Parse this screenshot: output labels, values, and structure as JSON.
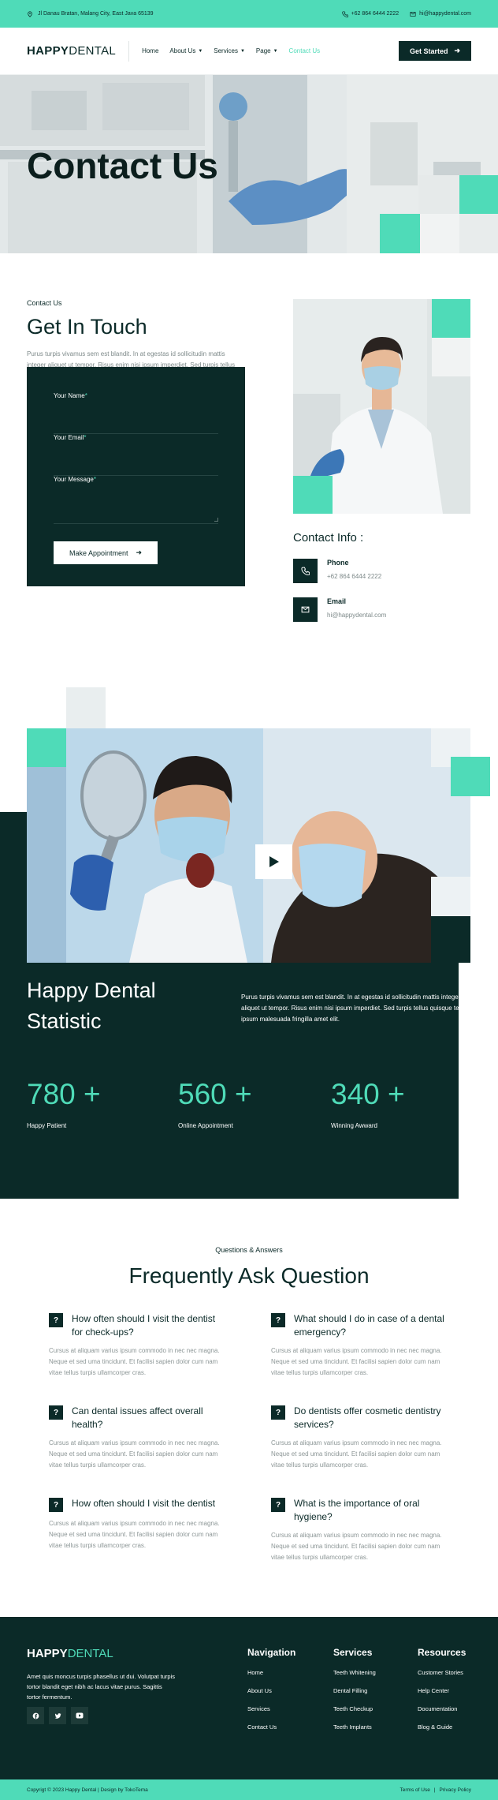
{
  "topbar": {
    "address": "Jl Danau Bratan, Malang City, East Java 65139",
    "phone": "+62 864 6444 2222",
    "email": "hi@happydental.com"
  },
  "header": {
    "logo_bold": "HAPPY",
    "logo_light": "DENTAL",
    "nav": [
      {
        "label": "Home",
        "dropdown": false,
        "active": false
      },
      {
        "label": "About Us",
        "dropdown": true,
        "active": false
      },
      {
        "label": "Services",
        "dropdown": true,
        "active": false
      },
      {
        "label": "Page",
        "dropdown": true,
        "active": true
      },
      {
        "label": "Contact Us",
        "dropdown": false,
        "active": true
      }
    ],
    "cta": "Get Started"
  },
  "hero": {
    "title": "Contact Us"
  },
  "contact": {
    "eyebrow": "Contact Us",
    "title": "Get In Touch",
    "lead": "Purus turpis vivamus sem est blandit. In at egestas id sollicitudin mattis integer aliquet ut tempor. Risus enim nisi ipsum imperdiet. Sed turpis tellus quisque tellus ipsum malesuada.",
    "form": {
      "name_label": "Your Name",
      "email_label": "Your Email",
      "message_label": "Your Message",
      "required_mark": "*",
      "submit": "Make Appointment"
    },
    "info": {
      "title": "Contact Info :",
      "phone_label": "Phone",
      "phone_value": "+62 864 6444 2222",
      "email_label": "Email",
      "email_value": "hi@happydental.com"
    }
  },
  "statistic": {
    "title": "Happy Dental Statistic",
    "description": "Purus turpis vivamus sem est blandit. In at egestas id sollicitudin mattis integer aliquet ut tempor. Risus enim nisi ipsum imperdiet. Sed turpis tellus quisque tellus ipsum malesuada fringilla amet elit.",
    "items": [
      {
        "number": "780 +",
        "label": "Happy Patient"
      },
      {
        "number": "560 +",
        "label": "Online Appointment"
      },
      {
        "number": "340 +",
        "label": "Winning Awward"
      }
    ]
  },
  "faq": {
    "eyebrow": "Questions & Answers",
    "title": "Frequently Ask Question",
    "icon": "?",
    "items": [
      {
        "q": "How often should I visit the dentist for check-ups?",
        "a": "Cursus at aliquam varius ipsum commodo in nec nec magna. Neque et sed uma tincidunt. Et facilisi sapien dolor cum nam vitae tellus turpis ullamcorper cras."
      },
      {
        "q": "What should I do in case of a dental emergency?",
        "a": "Cursus at aliquam varius ipsum commodo in nec nec magna. Neque et sed uma tincidunt. Et facilisi sapien dolor cum nam vitae tellus turpis ullamcorper cras."
      },
      {
        "q": "Can dental issues affect overall health?",
        "a": "Cursus at aliquam varius ipsum commodo in nec nec magna. Neque et sed uma tincidunt. Et facilisi sapien dolor cum nam vitae tellus turpis ullamcorper cras."
      },
      {
        "q": "Do dentists offer cosmetic dentistry services?",
        "a": "Cursus at aliquam varius ipsum commodo in nec nec magna. Neque et sed uma tincidunt. Et facilisi sapien dolor cum nam vitae tellus turpis ullamcorper cras."
      },
      {
        "q": "How often should I visit the dentist",
        "a": "Cursus at aliquam varius ipsum commodo in nec nec magna. Neque et sed uma tincidunt. Et facilisi sapien dolor cum nam vitae tellus turpis ullamcorper cras."
      },
      {
        "q": "What is the importance of oral hygiene?",
        "a": "Cursus at aliquam varius ipsum commodo in nec nec magna. Neque et sed uma tincidunt. Et facilisi sapien dolor cum nam vitae tellus turpis ullamcorper cras."
      }
    ]
  },
  "footer": {
    "logo_bold": "HAPPY",
    "logo_light": "DENTAL",
    "text": "Amet quis moncus turpis phasellus ut dui. Volutpat turpis tortor blandit eget nibh ac lacus vitae purus. Sagittis tortor fermentum.",
    "socials": [
      "facebook-icon",
      "twitter-icon",
      "youtube-icon"
    ],
    "columns": [
      {
        "title": "Navigation",
        "links": [
          "Home",
          "About Us",
          "Services",
          "Contact Us"
        ]
      },
      {
        "title": "Services",
        "links": [
          "Teeth Whitening",
          "Dental Filling",
          "Teeth Checkup",
          "Teeth Implants"
        ]
      },
      {
        "title": "Resources",
        "links": [
          "Customer Stories",
          "Help Center",
          "Documentation",
          "Blog & Guide"
        ]
      }
    ],
    "copyright": "Copyrigt © 2023 Happy Dental  |  Design by TokoTema",
    "terms": "Terms of Use",
    "privacy": "Privacy Policy",
    "separator": "|"
  },
  "colors": {
    "accent": "#4fdbb8",
    "dark": "#0b2a28"
  }
}
